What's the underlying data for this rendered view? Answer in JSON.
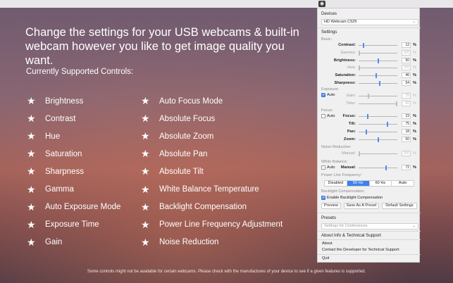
{
  "hero": {
    "headline": "Change the settings for your USB webcams & built-in webcam however you like to get image quality you want.",
    "subhead": "Currently Supported Controls:",
    "features_col1": [
      "Brightness",
      "Contrast",
      "Hue",
      "Saturation",
      "Sharpness",
      "Gamma",
      "Auto Exposure Mode",
      "Exposure Time",
      "Gain"
    ],
    "features_col2": [
      "Auto Focus Mode",
      "Absolute Focus",
      "Absolute Zoom",
      "Absolute Pan",
      "Absolute Tilt",
      "White Balance Temperature",
      "Backlight Compensation",
      "Power Line Frequency Adjustment",
      "Noise Reduction"
    ],
    "star_glyph": "★",
    "footer": "Some controls might not be available for certain webcams. Please check with the manufactures of your device to see if a given features is supported."
  },
  "panel": {
    "devices_header": "Devices",
    "device_selected": "HD Webcam C525",
    "settings_header": "Settings",
    "basic_label": "Basic:",
    "basic": [
      {
        "label": "Contrast:",
        "value": "12",
        "unit": "%",
        "level": 0.12,
        "enabled": true
      },
      {
        "label": "Gamma:",
        "value": "100",
        "unit": "%",
        "level": 0.0,
        "enabled": false
      },
      {
        "label": "Brightness:",
        "value": "50",
        "unit": "%",
        "level": 0.5,
        "enabled": true
      },
      {
        "label": "Hue:",
        "value": "100",
        "unit": "%",
        "level": 0.0,
        "enabled": false
      },
      {
        "label": "Saturation:",
        "value": "46",
        "unit": "%",
        "level": 0.46,
        "enabled": true
      },
      {
        "label": "Sharpness:",
        "value": "54",
        "unit": "%",
        "level": 0.54,
        "enabled": true
      }
    ],
    "exposure_label": "Exposure:",
    "exposure_auto": "Auto",
    "exposure": [
      {
        "label": "Gain:",
        "value": "25",
        "unit": "%",
        "level": 0.25,
        "enabled": false
      },
      {
        "label": "Time:",
        "value": "60",
        "unit": "%",
        "level": 1.0,
        "enabled": false
      }
    ],
    "focus_label": "Focus:",
    "focus_auto": "Auto",
    "focus": [
      {
        "label": "Focus:",
        "value": "23",
        "unit": "%",
        "level": 0.23,
        "enabled": true
      },
      {
        "label": "Tilt:",
        "value": "75",
        "unit": "%",
        "level": 0.75,
        "enabled": true
      },
      {
        "label": "Pan:",
        "value": "18",
        "unit": "%",
        "level": 0.18,
        "enabled": true
      },
      {
        "label": "Zoom:",
        "value": "50",
        "unit": "%",
        "level": 0.5,
        "enabled": true
      }
    ],
    "noise_label": "Noise Reduction:",
    "noise": {
      "label": "Manual:",
      "value": "100",
      "unit": "%",
      "level": 0.0,
      "enabled": false
    },
    "wb_label": "White Balance:",
    "wb_auto": "Auto",
    "wb": {
      "label": "Manual:",
      "value": "72",
      "unit": "%",
      "level": 0.72,
      "enabled": true
    },
    "plf_label": "Power Line Frequency:",
    "plf_options": [
      "Disabled",
      "50 Hz",
      "60 Hz",
      "Auto"
    ],
    "plf_selected": "50 Hz",
    "backlight_label": "Backlight Compensation:",
    "backlight_check": "Enable Backlight Compensation",
    "buttons": {
      "preview": "Preview",
      "save_preset": "Save As A Preset",
      "default": "Default Settings"
    },
    "presets_header": "Presets",
    "presets_placeholder": "Settings for Conferences",
    "about_header": "About Info & Technical Support",
    "menu": {
      "about": "About",
      "contact": "Contact the Developer for Technical Support",
      "quit": "Quit"
    },
    "accent_color": "#3b82f0"
  }
}
